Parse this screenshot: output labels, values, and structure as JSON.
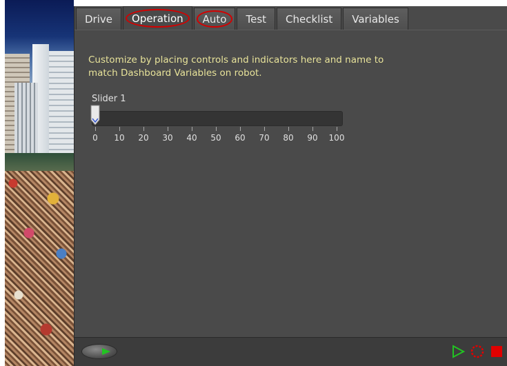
{
  "tabs": [
    {
      "label": "Drive"
    },
    {
      "label": "Operation"
    },
    {
      "label": "Auto"
    },
    {
      "label": "Test"
    },
    {
      "label": "Checklist"
    },
    {
      "label": "Variables"
    }
  ],
  "content": {
    "description": "Customize by placing controls and indicators here and name to match Dashboard Variables on robot.",
    "slider": {
      "label": "Slider 1",
      "value": 0,
      "ticks": [
        "0",
        "10",
        "20",
        "30",
        "40",
        "50",
        "60",
        "70",
        "80",
        "90",
        "100"
      ]
    }
  },
  "colors": {
    "panel_bg": "#4a4a4a",
    "description_text": "#e8e39a",
    "annotation_circle": "#d40000",
    "run_green": "#22c322",
    "stop_red": "#e00000"
  },
  "icons": {
    "run": "play-arrow-icon",
    "play": "play-outline-icon",
    "record": "record-dotted-circle-icon",
    "stop": "stop-square-icon"
  }
}
